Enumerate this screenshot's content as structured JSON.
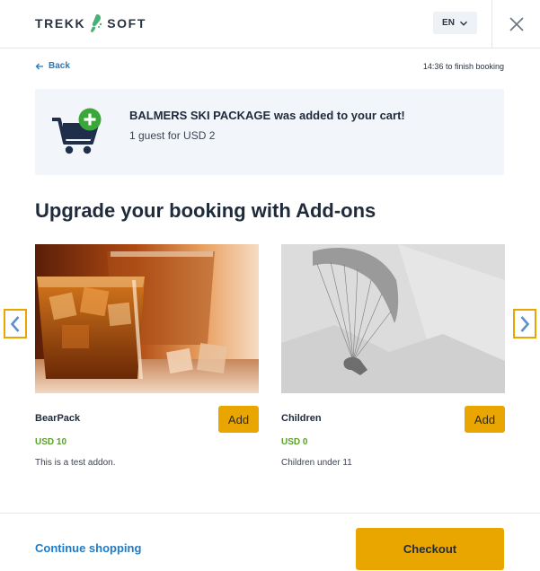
{
  "header": {
    "logo_text_left": "TREKK",
    "logo_text_right": "SOFT",
    "language": "EN"
  },
  "nav": {
    "back_label": "Back",
    "timer_text": "14:36 to finish booking"
  },
  "cart_notice": {
    "title": "BALMERS SKI PACKAGE was added to your cart!",
    "subtitle": "1 guest for USD 2"
  },
  "addons": {
    "heading": "Upgrade your booking with Add-ons",
    "items": [
      {
        "name": "BearPack",
        "add_label": "Add",
        "price": "USD 10",
        "description": "This is a test addon."
      },
      {
        "name": "Children",
        "add_label": "Add",
        "price": "USD 0",
        "description": "Children under 11"
      }
    ]
  },
  "footer": {
    "continue_label": "Continue shopping",
    "checkout_label": "Checkout"
  },
  "colors": {
    "accent": "#e9a600",
    "link": "#1f7bc6",
    "price": "#5aa02c",
    "notice_bg": "#f2f5fa",
    "plus_badge": "#3aa73a"
  }
}
